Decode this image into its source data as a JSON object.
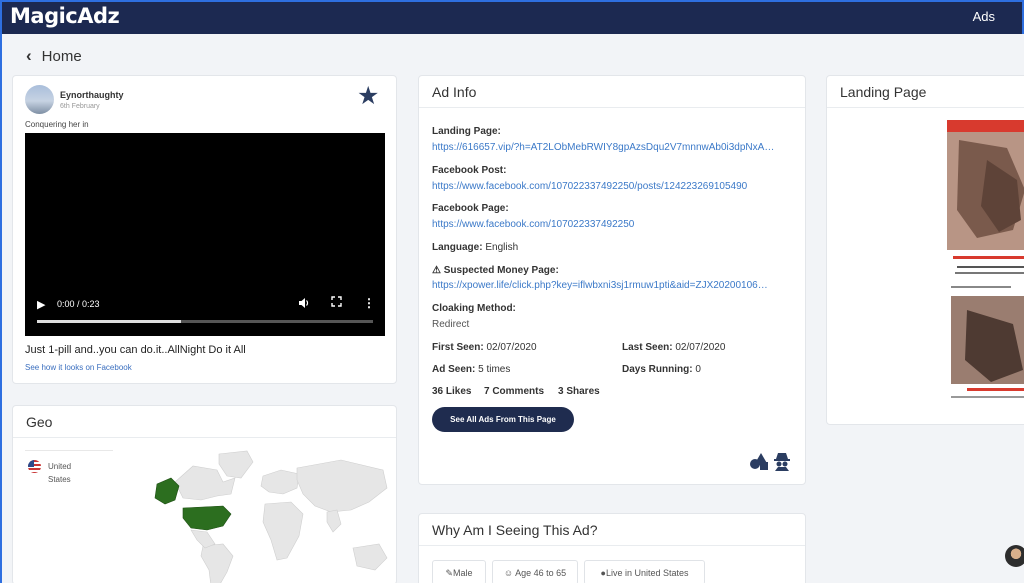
{
  "app": {
    "logo": "MagicAdz",
    "nav_ads": "Ads"
  },
  "breadcrumb": {
    "home": "Home"
  },
  "post": {
    "author": "Eynorthaughty",
    "date": "6th February",
    "caption": "Conquering her in",
    "video_time": "0:00 / 0:23",
    "video_progress_fraction": 0.43,
    "text": "Just 1-pill and..you can do.it..AllNight Do it All",
    "facebook_link": "See how it looks on Facebook"
  },
  "geo": {
    "title": "Geo",
    "country": "United States",
    "highlight_color": "#2c6e1f"
  },
  "ad_info": {
    "title": "Ad Info",
    "landing_label": "Landing Page:",
    "landing_value": "https://616657.vip/?h=AT2LObMebRWIY8gpAzsDqu2V7mnnwAb0i3dpNxA…",
    "post_label": "Facebook Post:",
    "post_value": "https://www.facebook.com/107022337492250/posts/124223269105490",
    "page_label": "Facebook Page:",
    "page_value": "https://www.facebook.com/107022337492250",
    "language_label": "Language:",
    "language_value": "English",
    "money_label": "Suspected Money Page:",
    "money_value": "https://xpower.life/click.php?key=iflwbxni3sj1rmuw1pti&aid=ZJX20200106…",
    "cloak_label": "Cloaking Method:",
    "cloak_value": "Redirect",
    "first_seen_label": "First Seen:",
    "first_seen_value": "02/07/2020",
    "last_seen_label": "Last Seen:",
    "last_seen_value": "02/07/2020",
    "ad_seen_label": "Ad Seen:",
    "ad_seen_value": "5 times",
    "days_running_label": "Days Running:",
    "days_running_value": "0",
    "likes": "36 Likes",
    "comments": "7 Comments",
    "shares": "3 Shares",
    "button": "See All Ads From This Page"
  },
  "why": {
    "title": "Why Am I Seeing This Ad?",
    "chips": [
      "Male",
      "Age 46 to 65",
      "Live in United States"
    ]
  },
  "landing": {
    "title": "Landing Page"
  }
}
